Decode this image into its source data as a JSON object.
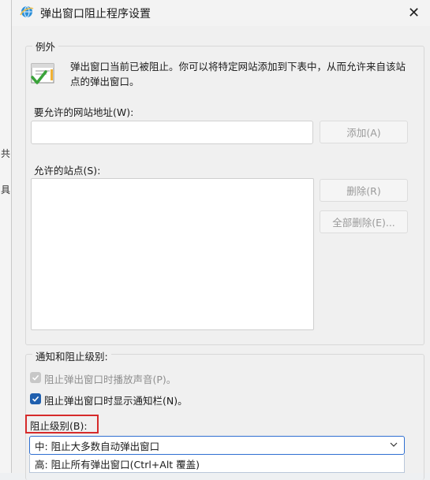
{
  "background_app": {
    "glyph_1": "共",
    "glyph_2": "具"
  },
  "dialog": {
    "title": "弹出窗口阻止程序设置",
    "close_symbol": "✕",
    "exceptions": {
      "legend": "例外",
      "description": "弹出窗口当前已被阻止。你可以将特定网站添加到下表中，从而允许来自该站点的弹出窗口。",
      "address_label": "要允许的网站地址(W):",
      "address_value": "",
      "add_button": "添加(A)",
      "allowed_label": "允许的站点(S):",
      "allowed_sites": [],
      "remove_button": "删除(R)",
      "remove_all_button": "全部删除(E)..."
    },
    "notification": {
      "legend": "通知和阻止级别:",
      "play_sound": {
        "label": "阻止弹出窗口时播放声音(P)。",
        "checked": true,
        "disabled": true
      },
      "show_bar": {
        "label": "阻止弹出窗口时显示通知栏(N)。",
        "checked": true,
        "disabled": false
      },
      "level_label": "阻止级别(B):",
      "level_selected": "中: 阻止大多数自动弹出窗口",
      "level_option_high": "高: 阻止所有弹出窗口(Ctrl+Alt 覆盖)"
    }
  },
  "colors": {
    "accent": "#1f5fae",
    "highlight": "#d62b2b"
  },
  "icons": {
    "title": "ie-globe-icon",
    "info": "popup-window-check-icon",
    "close": "close-icon",
    "dropdown": "chevron-down-icon"
  }
}
